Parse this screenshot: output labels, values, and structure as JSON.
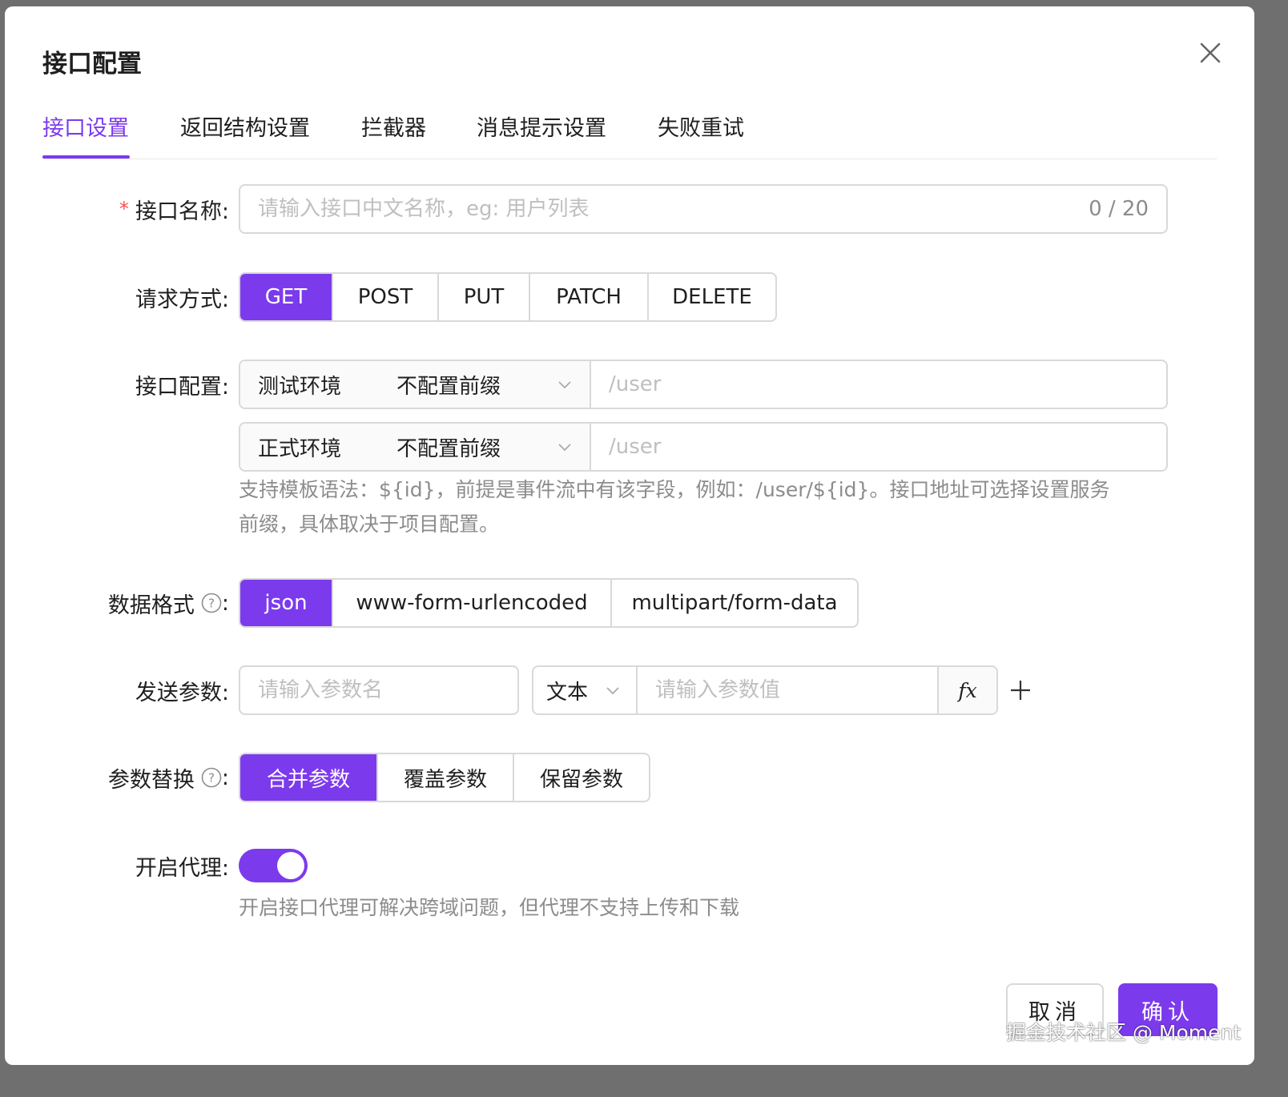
{
  "title": "接口配置",
  "tabs": [
    {
      "label": "接口设置",
      "active": true
    },
    {
      "label": "返回结构设置"
    },
    {
      "label": "拦截器"
    },
    {
      "label": "消息提示设置"
    },
    {
      "label": "失败重试"
    }
  ],
  "form": {
    "name": {
      "label": "接口名称:",
      "placeholder": "请输入接口中文名称，eg: 用户列表",
      "count": "0 / 20"
    },
    "method": {
      "label": "请求方式:",
      "options": [
        "GET",
        "POST",
        "PUT",
        "PATCH",
        "DELETE"
      ],
      "selected": "GET"
    },
    "config": {
      "label": "接口配置:",
      "envs": [
        {
          "name": "测试环境",
          "prefix": "不配置前缀",
          "path": "/user"
        },
        {
          "name": "正式环境",
          "prefix": "不配置前缀",
          "path": "/user"
        }
      ],
      "hint_line1": "支持模板语法：${id}，前提是事件流中有该字段，例如：/user/${id}。接口地址可选择设置服务",
      "hint_line2": "前缀，具体取决于项目配置。"
    },
    "format": {
      "label": "数据格式",
      "colon": ":",
      "options": [
        "json",
        "www-form-urlencoded",
        "multipart/form-data"
      ],
      "selected": "json"
    },
    "params": {
      "label": "发送参数:",
      "name_placeholder": "请输入参数名",
      "type": "文本",
      "value_placeholder": "请输入参数值",
      "fx": "fx"
    },
    "replace": {
      "label": "参数替换",
      "colon": ":",
      "options": [
        "合并参数",
        "覆盖参数",
        "保留参数"
      ],
      "selected": "合并参数"
    },
    "proxy": {
      "label": "开启代理:",
      "enabled": true,
      "hint": "开启接口代理可解决跨域问题，但代理不支持上传和下载"
    }
  },
  "footer": {
    "cancel": "取消",
    "ok": "确认"
  },
  "watermark": "掘金技术社区 @ Moment",
  "colors": {
    "accent": "#7c3aed",
    "required": "#ff4d4f"
  }
}
